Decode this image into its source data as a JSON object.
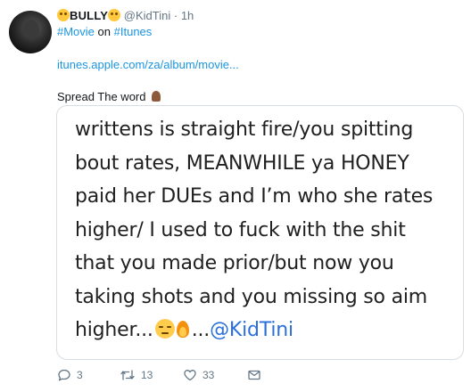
{
  "tweet": {
    "display_name": "BULLY",
    "handle": "@KidTini",
    "separator": "·",
    "time": "1h",
    "hashtag_movie": "#Movie",
    "on_word": "on",
    "hashtag_itunes": "#Itunes",
    "link_url": "itunes.apple.com/za/album/movie...",
    "body": "Spread The word",
    "body_emoji": "folded-hands-emoji"
  },
  "media": {
    "lines": [
      "writtens is straight fire/you spitting",
      "bout rates, MEANWHILE ya HONEY",
      "paid her DUEs and I’m who she rates",
      "higher/ I used to fuck with the shit",
      "that you made prior/but now you",
      "taking shots and you missing so aim"
    ],
    "last_line_prefix": "higher...",
    "last_line_mid": "...",
    "mention": "@KidTini"
  },
  "actions": {
    "reply_count": "3",
    "retweet_count": "13",
    "like_count": "33"
  },
  "icons": {
    "reply": "reply-icon",
    "retweet": "retweet-icon",
    "like": "heart-icon",
    "message": "direct-message-icon"
  },
  "colors": {
    "link": "#1b95e0",
    "muted": "#657786",
    "text": "#14171a",
    "mention_in_image": "#2a6fdb"
  }
}
